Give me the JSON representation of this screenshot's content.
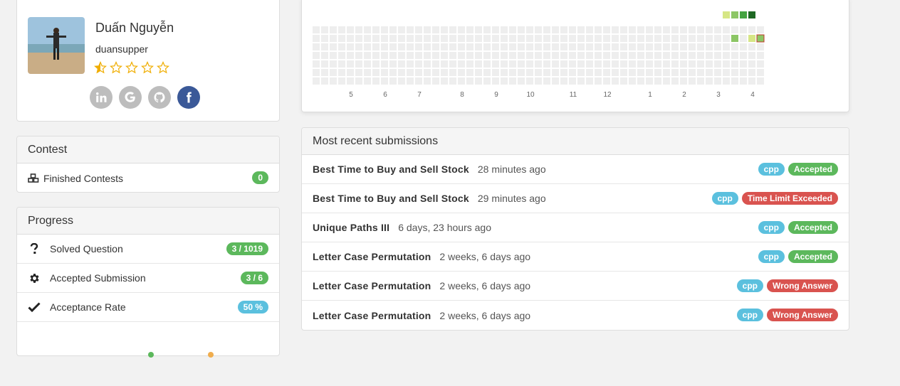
{
  "profile": {
    "name": "Duấn Nguyễn",
    "username": "duansupper",
    "rating": "1.5 / 5",
    "social_icons": [
      "linkedin-icon",
      "google-icon",
      "github-icon",
      "facebook-icon"
    ]
  },
  "contest": {
    "title": "Contest",
    "finished_label": "Finished Contests",
    "finished_count": "0"
  },
  "progress": {
    "title": "Progress",
    "items": [
      {
        "label": "Solved Question",
        "value": "3 / 1019",
        "icon": "question-icon"
      },
      {
        "label": "Accepted Submission",
        "value": "3 / 6",
        "icon": "gear-icon"
      },
      {
        "label": "Acceptance Rate",
        "value": "50 %",
        "icon": "check-icon"
      }
    ]
  },
  "heatmap": {
    "month_labels": [
      "5",
      "6",
      "7",
      "8",
      "9",
      "10",
      "11",
      "12",
      "1",
      "2",
      "3",
      "4"
    ],
    "legend_colors": [
      "#d6e685",
      "#8cc665",
      "#44a340",
      "#1e6823"
    ]
  },
  "submissions": {
    "title": "Most recent submissions",
    "items": [
      {
        "title": "Best Time to Buy and Sell Stock",
        "time": "28 minutes ago",
        "lang": "cpp",
        "status": "Accepted"
      },
      {
        "title": "Best Time to Buy and Sell Stock",
        "time": "29 minutes ago",
        "lang": "cpp",
        "status": "Time Limit Exceeded"
      },
      {
        "title": "Unique Paths III",
        "time": "6 days, 23 hours ago",
        "lang": "cpp",
        "status": "Accepted"
      },
      {
        "title": "Letter Case Permutation",
        "time": "2 weeks, 6 days ago",
        "lang": "cpp",
        "status": "Accepted"
      },
      {
        "title": "Letter Case Permutation",
        "time": "2 weeks, 6 days ago",
        "lang": "cpp",
        "status": "Wrong Answer"
      },
      {
        "title": "Letter Case Permutation",
        "time": "2 weeks, 6 days ago",
        "lang": "cpp",
        "status": "Wrong Answer"
      }
    ]
  },
  "colors": {
    "accepted": "#5cb85c",
    "rejected": "#d9534f",
    "lang": "#5bc0de",
    "empty_cell": "#eeeeee"
  }
}
